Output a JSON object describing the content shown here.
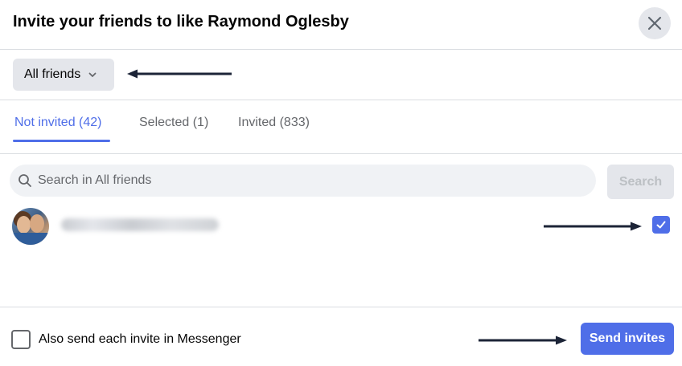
{
  "dialog": {
    "title": "Invite your friends to like Raymond Oglesby",
    "close_icon": "close-icon"
  },
  "filter": {
    "selected": "All friends",
    "icon": "chevron-down-icon"
  },
  "tabs": [
    {
      "label": "Not invited (42)",
      "active": true
    },
    {
      "label": "Selected (1)",
      "active": false
    },
    {
      "label": "Invited (833)",
      "active": false
    }
  ],
  "search": {
    "placeholder": "Search in All friends",
    "value": "",
    "button_label": "Search",
    "icon": "search-icon"
  },
  "friends": [
    {
      "name_blurred": true,
      "selected": true
    }
  ],
  "footer": {
    "messenger_label": "Also send each invite in Messenger",
    "messenger_checked": false,
    "send_label": "Send invites"
  },
  "colors": {
    "accent": "#4f6ee8",
    "secondary_bg": "#e4e6eb",
    "search_bg": "#f0f2f5",
    "arrow": "#1c2437"
  }
}
